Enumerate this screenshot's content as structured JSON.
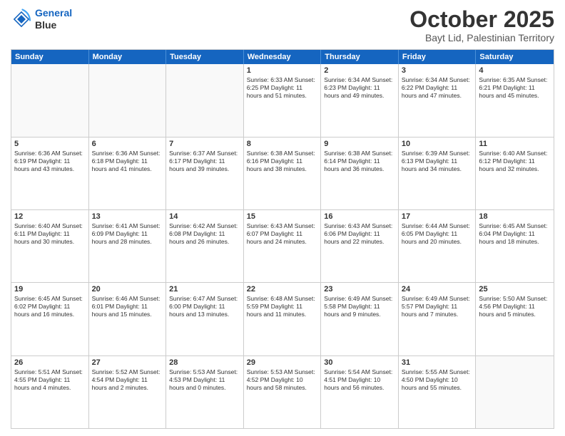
{
  "logo": {
    "line1": "General",
    "line2": "Blue"
  },
  "header": {
    "month": "October 2025",
    "location": "Bayt Lid, Palestinian Territory"
  },
  "days": [
    "Sunday",
    "Monday",
    "Tuesday",
    "Wednesday",
    "Thursday",
    "Friday",
    "Saturday"
  ],
  "rows": [
    [
      {
        "day": "",
        "text": ""
      },
      {
        "day": "",
        "text": ""
      },
      {
        "day": "",
        "text": ""
      },
      {
        "day": "1",
        "text": "Sunrise: 6:33 AM\nSunset: 6:25 PM\nDaylight: 11 hours\nand 51 minutes."
      },
      {
        "day": "2",
        "text": "Sunrise: 6:34 AM\nSunset: 6:23 PM\nDaylight: 11 hours\nand 49 minutes."
      },
      {
        "day": "3",
        "text": "Sunrise: 6:34 AM\nSunset: 6:22 PM\nDaylight: 11 hours\nand 47 minutes."
      },
      {
        "day": "4",
        "text": "Sunrise: 6:35 AM\nSunset: 6:21 PM\nDaylight: 11 hours\nand 45 minutes."
      }
    ],
    [
      {
        "day": "5",
        "text": "Sunrise: 6:36 AM\nSunset: 6:19 PM\nDaylight: 11 hours\nand 43 minutes."
      },
      {
        "day": "6",
        "text": "Sunrise: 6:36 AM\nSunset: 6:18 PM\nDaylight: 11 hours\nand 41 minutes."
      },
      {
        "day": "7",
        "text": "Sunrise: 6:37 AM\nSunset: 6:17 PM\nDaylight: 11 hours\nand 39 minutes."
      },
      {
        "day": "8",
        "text": "Sunrise: 6:38 AM\nSunset: 6:16 PM\nDaylight: 11 hours\nand 38 minutes."
      },
      {
        "day": "9",
        "text": "Sunrise: 6:38 AM\nSunset: 6:14 PM\nDaylight: 11 hours\nand 36 minutes."
      },
      {
        "day": "10",
        "text": "Sunrise: 6:39 AM\nSunset: 6:13 PM\nDaylight: 11 hours\nand 34 minutes."
      },
      {
        "day": "11",
        "text": "Sunrise: 6:40 AM\nSunset: 6:12 PM\nDaylight: 11 hours\nand 32 minutes."
      }
    ],
    [
      {
        "day": "12",
        "text": "Sunrise: 6:40 AM\nSunset: 6:11 PM\nDaylight: 11 hours\nand 30 minutes."
      },
      {
        "day": "13",
        "text": "Sunrise: 6:41 AM\nSunset: 6:09 PM\nDaylight: 11 hours\nand 28 minutes."
      },
      {
        "day": "14",
        "text": "Sunrise: 6:42 AM\nSunset: 6:08 PM\nDaylight: 11 hours\nand 26 minutes."
      },
      {
        "day": "15",
        "text": "Sunrise: 6:43 AM\nSunset: 6:07 PM\nDaylight: 11 hours\nand 24 minutes."
      },
      {
        "day": "16",
        "text": "Sunrise: 6:43 AM\nSunset: 6:06 PM\nDaylight: 11 hours\nand 22 minutes."
      },
      {
        "day": "17",
        "text": "Sunrise: 6:44 AM\nSunset: 6:05 PM\nDaylight: 11 hours\nand 20 minutes."
      },
      {
        "day": "18",
        "text": "Sunrise: 6:45 AM\nSunset: 6:04 PM\nDaylight: 11 hours\nand 18 minutes."
      }
    ],
    [
      {
        "day": "19",
        "text": "Sunrise: 6:45 AM\nSunset: 6:02 PM\nDaylight: 11 hours\nand 16 minutes."
      },
      {
        "day": "20",
        "text": "Sunrise: 6:46 AM\nSunset: 6:01 PM\nDaylight: 11 hours\nand 15 minutes."
      },
      {
        "day": "21",
        "text": "Sunrise: 6:47 AM\nSunset: 6:00 PM\nDaylight: 11 hours\nand 13 minutes."
      },
      {
        "day": "22",
        "text": "Sunrise: 6:48 AM\nSunset: 5:59 PM\nDaylight: 11 hours\nand 11 minutes."
      },
      {
        "day": "23",
        "text": "Sunrise: 6:49 AM\nSunset: 5:58 PM\nDaylight: 11 hours\nand 9 minutes."
      },
      {
        "day": "24",
        "text": "Sunrise: 6:49 AM\nSunset: 5:57 PM\nDaylight: 11 hours\nand 7 minutes."
      },
      {
        "day": "25",
        "text": "Sunrise: 5:50 AM\nSunset: 4:56 PM\nDaylight: 11 hours\nand 5 minutes."
      }
    ],
    [
      {
        "day": "26",
        "text": "Sunrise: 5:51 AM\nSunset: 4:55 PM\nDaylight: 11 hours\nand 4 minutes."
      },
      {
        "day": "27",
        "text": "Sunrise: 5:52 AM\nSunset: 4:54 PM\nDaylight: 11 hours\nand 2 minutes."
      },
      {
        "day": "28",
        "text": "Sunrise: 5:53 AM\nSunset: 4:53 PM\nDaylight: 11 hours\nand 0 minutes."
      },
      {
        "day": "29",
        "text": "Sunrise: 5:53 AM\nSunset: 4:52 PM\nDaylight: 10 hours\nand 58 minutes."
      },
      {
        "day": "30",
        "text": "Sunrise: 5:54 AM\nSunset: 4:51 PM\nDaylight: 10 hours\nand 56 minutes."
      },
      {
        "day": "31",
        "text": "Sunrise: 5:55 AM\nSunset: 4:50 PM\nDaylight: 10 hours\nand 55 minutes."
      },
      {
        "day": "",
        "text": ""
      }
    ]
  ]
}
